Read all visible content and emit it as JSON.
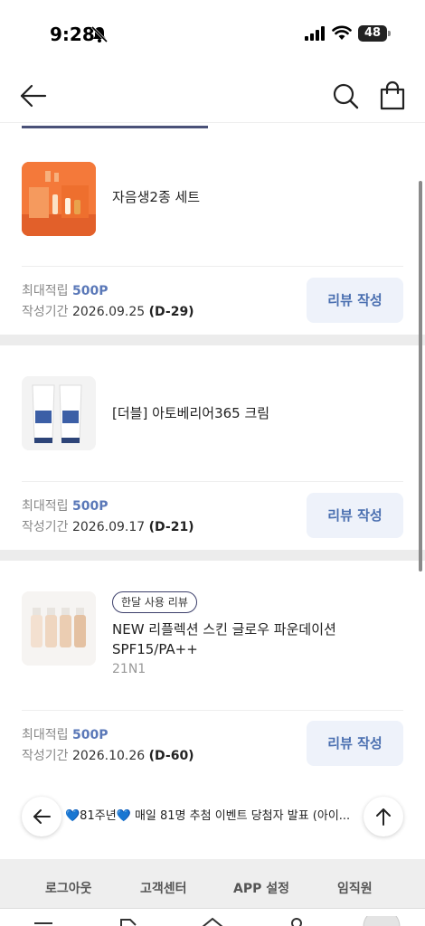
{
  "status_bar": {
    "time": "9:28",
    "battery": "48"
  },
  "header": {
    "back": "back",
    "search": "search",
    "cart": "cart"
  },
  "reviews": [
    {
      "product_name": "자음생2종 세트",
      "points_label": "최대적립",
      "points_value": "500P",
      "period_label": "작성기간",
      "period_date": "2026.09.25",
      "dday": "(D-29)",
      "button": "리뷰 작성"
    },
    {
      "product_name": "[더블] 아토베리어365 크림",
      "points_label": "최대적립",
      "points_value": "500P",
      "period_label": "작성기간",
      "period_date": "2026.09.17",
      "dday": "(D-21)",
      "button": "리뷰 작성"
    },
    {
      "badge": "한달 사용 리뷰",
      "product_name_line1": "NEW 리플렉션 스킨 글로우 파운데이션",
      "product_name_line2": "SPF15/PA++",
      "option": "21N1",
      "points_label": "최대적립",
      "points_value": "500P",
      "period_label": "작성기간",
      "period_date": "2026.10.26",
      "dday": "(D-60)",
      "button": "리뷰 작성"
    }
  ],
  "notice": {
    "text": "💙81주년💙 매일 81명 추첨 이벤트 당첨자 발표 (아이..."
  },
  "footer": {
    "links": [
      "로그아웃",
      "고객센터",
      "APP 설정",
      "임직원"
    ]
  },
  "colors": {
    "accent": "#5a78b8",
    "button_bg": "#eef2fa",
    "tab_indicator": "#4a5178"
  }
}
